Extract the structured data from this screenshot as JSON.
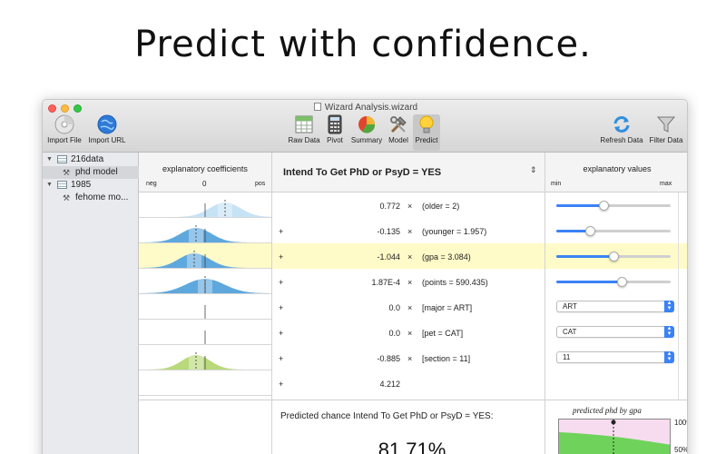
{
  "headline": "Predict with confidence.",
  "window": {
    "title": "Wizard Analysis.wizard"
  },
  "toolbar": {
    "left": [
      {
        "label": "Import File",
        "icon": "import-file-icon"
      },
      {
        "label": "Import URL",
        "icon": "globe-icon"
      }
    ],
    "center": [
      {
        "label": "Raw Data",
        "icon": "table-icon"
      },
      {
        "label": "Pivot",
        "icon": "calculator-icon"
      },
      {
        "label": "Summary",
        "icon": "pie-chart-icon"
      },
      {
        "label": "Model",
        "icon": "tools-icon"
      },
      {
        "label": "Predict",
        "icon": "lightbulb-icon",
        "active": true
      }
    ],
    "right": [
      {
        "label": "Refresh Data",
        "icon": "refresh-icon"
      },
      {
        "label": "Filter Data",
        "icon": "funnel-icon"
      }
    ]
  },
  "sidebar": {
    "items": [
      {
        "label": "216data",
        "type": "dataset",
        "expanded": true
      },
      {
        "label": "phd model",
        "type": "model",
        "selected": true
      },
      {
        "label": "1985",
        "type": "dataset",
        "expanded": true
      },
      {
        "label": "fehome mo...",
        "type": "model"
      }
    ]
  },
  "columns": {
    "coefficients": {
      "title": "explanatory coefficients",
      "neg": "neg",
      "zero": "0",
      "pos": "pos"
    },
    "equation": {
      "title": "Intend To Get PhD or PsyD = YES"
    },
    "values": {
      "title": "explanatory values",
      "min": "min",
      "max": "max"
    }
  },
  "terms": [
    {
      "plus": "",
      "value": "0.772",
      "times": "×",
      "name": "(older = 2)",
      "control": "slider",
      "level": 0.41,
      "shade": "light"
    },
    {
      "plus": "+",
      "value": "-0.135",
      "times": "×",
      "name": "(younger = 1.957)",
      "control": "slider",
      "level": 0.29,
      "shade": "dark"
    },
    {
      "plus": "+",
      "value": "-1.044",
      "times": "×",
      "name": "(gpa = 3.084)",
      "control": "slider",
      "level": 0.5,
      "shade": "dark",
      "highlight": true
    },
    {
      "plus": "+",
      "value": "1.87E-4",
      "times": "×",
      "name": "(points = 590.435)",
      "control": "slider",
      "level": 0.57,
      "shade": "dark"
    },
    {
      "plus": "+",
      "value": "0.0",
      "times": "×",
      "name": "[major = ART]",
      "control": "popup",
      "selected": "ART"
    },
    {
      "plus": "+",
      "value": "0.0",
      "times": "×",
      "name": "[pet = CAT]",
      "control": "popup",
      "selected": "CAT"
    },
    {
      "plus": "+",
      "value": "-0.885",
      "times": "×",
      "name": "[section = 11]",
      "control": "popup",
      "selected": "11",
      "shade": "green"
    },
    {
      "plus": "+",
      "value": "4.212",
      "times": "",
      "name": "",
      "control": "none"
    }
  ],
  "prediction": {
    "label": "Predicted chance Intend To Get PhD or PsyD = YES:",
    "value": "81.71%"
  },
  "mini_chart": {
    "title": "predicted phd by gpa",
    "ticks": [
      "100%",
      "50%"
    ],
    "colors": {
      "fill": "#6fd35b",
      "bg": "#f7dcef"
    }
  },
  "colors": {
    "accent": "#3b82f6",
    "highlight": "#fffbc8",
    "curve_light": "#c6e2f5",
    "curve_dark": "#5ea8dd",
    "curve_green": "#b9d97a"
  }
}
